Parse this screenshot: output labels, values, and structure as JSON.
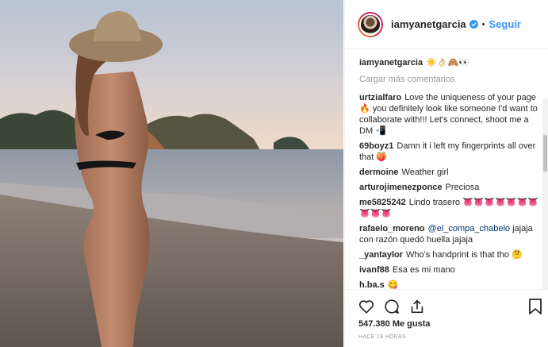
{
  "post": {
    "username": "iamyanetgarcia",
    "follow_label": "Seguir",
    "dot": "•",
    "caption_emoji": "☀️👌🏻🙈👀",
    "load_more": "Cargar más comentarios",
    "likes": "547.380 Me gusta",
    "timestamp": "HACE 18 HORAS"
  },
  "comments": [
    {
      "user": "urtzialfaro",
      "text": "Love the uniqueness of your page🔥 you definitely look like someone I'd want to collaborate with!!! Let's connect, shoot me a DM 📲"
    },
    {
      "user": "69boyz1",
      "text": "Damn it i left my fingerprints all over that 🍑"
    },
    {
      "user": "dermoine",
      "text": "Weather girl"
    },
    {
      "user": "arturojimenezponce",
      "text": "Preciosa"
    },
    {
      "user": "me5825242",
      "text": "Lindo trasero 👅👅👅👅👅👅👅👅👅👅"
    },
    {
      "user": "rafaelo_moreno",
      "mention": "@el_compa_chabelo",
      "text": "jajaja con razón quedó huella jajaja"
    },
    {
      "user": "_yantaylor",
      "text": "Who's handprint is that tho 🤔"
    },
    {
      "user": "ivanf88",
      "text": "Esa es mi mano"
    },
    {
      "user": "h.ba.s",
      "text": "😋"
    }
  ],
  "colors": {
    "link_blue": "#3897f0",
    "text": "#262626",
    "muted": "#999999",
    "border": "#efefef"
  },
  "icons": [
    "verified-badge-icon",
    "heart-icon",
    "comment-icon",
    "share-icon",
    "bookmark-icon"
  ]
}
